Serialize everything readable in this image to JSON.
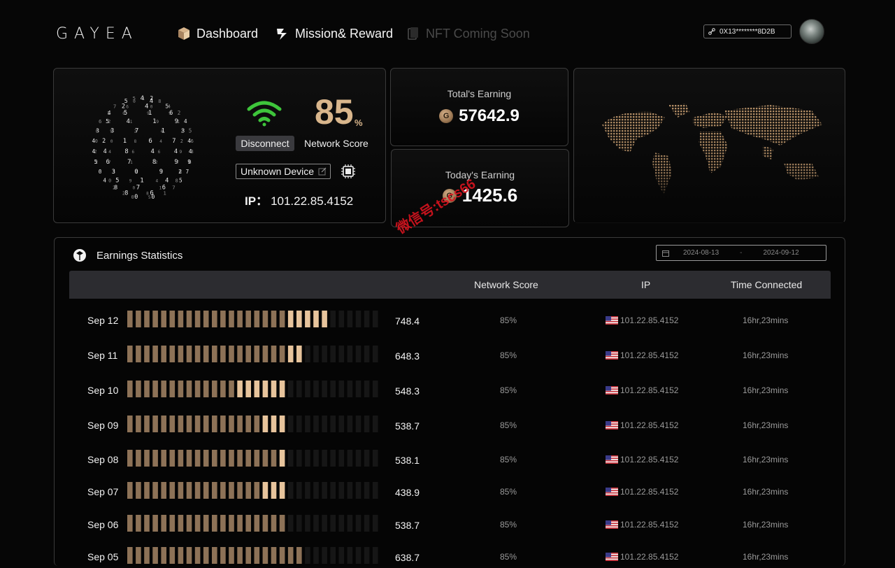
{
  "app": {
    "logo": "GAYEA"
  },
  "nav": {
    "items": [
      {
        "label": "Dashboard",
        "icon": "cube-icon"
      },
      {
        "label": "Mission& Reward",
        "icon": "lightning-icon"
      },
      {
        "label": "NFT  Coming Soon",
        "icon": "card-icon"
      }
    ],
    "wallet": "0X13********8D2B"
  },
  "device": {
    "score": "85",
    "score_unit": "%",
    "disconnect_label": "Disconnect",
    "score_label": "Network Score",
    "device_name": "Unknown Device",
    "ip_label": "IP：",
    "ip_value": "101.22.85.4152",
    "wifi_color": "#3ec53b",
    "accent": "#d9b68c"
  },
  "earnings": {
    "total_label": "Total's Earning",
    "total_value": "57642.9",
    "today_label": "Today's Earning",
    "today_value": "1425.6"
  },
  "stats": {
    "title": "Earnings Statistics",
    "date_from": "2024-08-13",
    "date_sep": "-",
    "date_to": "2024-09-12",
    "columns": {
      "network_score": "Network Score",
      "ip": "IP",
      "time_connected": "Time Connected"
    },
    "rows": [
      {
        "date": "Sep 12",
        "value": "748.4",
        "score": "85%",
        "ip": "101.22.85.4152",
        "time": "16hr,23mins",
        "filled": 24,
        "highlight": 5
      },
      {
        "date": "Sep 11",
        "value": "648.3",
        "score": "85%",
        "ip": "101.22.85.4152",
        "time": "16hr,23mins",
        "filled": 21,
        "highlight": 2
      },
      {
        "date": "Sep 10",
        "value": "548.3",
        "score": "85%",
        "ip": "101.22.85.4152",
        "time": "16hr,23mins",
        "filled": 19,
        "highlight": 6
      },
      {
        "date": "Sep 09",
        "value": "538.7",
        "score": "85%",
        "ip": "101.22.85.4152",
        "time": "16hr,23mins",
        "filled": 19,
        "highlight": 3
      },
      {
        "date": "Sep 08",
        "value": "538.1",
        "score": "85%",
        "ip": "101.22.85.4152",
        "time": "16hr,23mins",
        "filled": 19,
        "highlight": 1
      },
      {
        "date": "Sep 07",
        "value": "438.9",
        "score": "85%",
        "ip": "101.22.85.4152",
        "time": "16hr,23mins",
        "filled": 19,
        "highlight": 3
      },
      {
        "date": "Sep 06",
        "value": "538.7",
        "score": "85%",
        "ip": "101.22.85.4152",
        "time": "16hr,23mins",
        "filled": 19,
        "highlight": 0
      },
      {
        "date": "Sep 05",
        "value": "638.7",
        "score": "85%",
        "ip": "101.22.85.4152",
        "time": "16hr,23mins",
        "filled": 21,
        "highlight": 0
      }
    ]
  },
  "colors": {
    "bar_base": "#8d7257",
    "bar_highlight": "#e7c49c",
    "bar_empty": "#161616"
  },
  "watermark": "微信号:tscs66"
}
